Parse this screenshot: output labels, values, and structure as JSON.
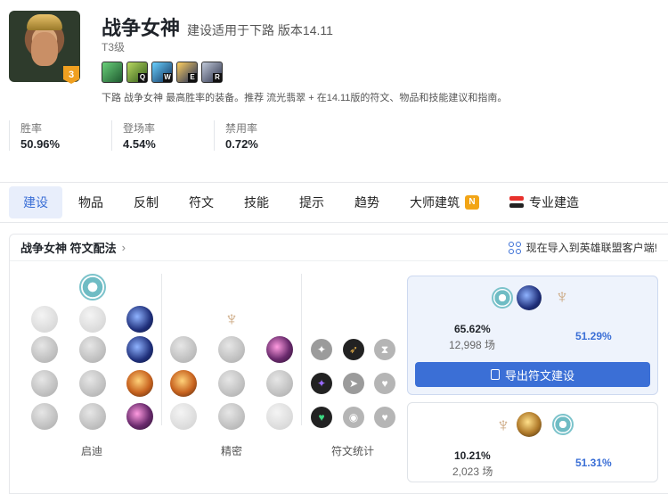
{
  "champion": {
    "name": "战争女神",
    "subtitle": "建设适用于下路 版本14.11",
    "tier_badge": "3",
    "tier_text": "T3级",
    "description": "下路 战争女神 最高胜率的装备。推荐 流光翡翠 + 在14.11版的符文、物品和技能建议和指南。"
  },
  "skills": [
    {
      "key": "",
      "name": "passive-icon",
      "color": "#2f8a4f"
    },
    {
      "key": "Q",
      "name": "skill-q-icon",
      "color": "#4f8a2a"
    },
    {
      "key": "W",
      "name": "skill-w-icon",
      "color": "#2a6aa0"
    },
    {
      "key": "E",
      "name": "skill-e-icon",
      "color": "#c98a1a"
    },
    {
      "key": "R",
      "name": "skill-r-icon",
      "color": "#3a4a6a"
    }
  ],
  "stats": [
    {
      "label": "胜率",
      "value": "50.96%"
    },
    {
      "label": "登场率",
      "value": "4.54%"
    },
    {
      "label": "禁用率",
      "value": "0.72%"
    }
  ],
  "tabs": [
    {
      "label": "建设",
      "active": true
    },
    {
      "label": "物品"
    },
    {
      "label": "反制"
    },
    {
      "label": "符文"
    },
    {
      "label": "技能"
    },
    {
      "label": "提示"
    },
    {
      "label": "趋势"
    },
    {
      "label": "大师建筑",
      "badge": "N"
    },
    {
      "label": "专业建造"
    }
  ],
  "runes_section": {
    "title": "战争女神 符文配法",
    "import_text": "现在导入到英雄联盟客户端!",
    "col_labels": [
      "启迪",
      "精密",
      "符文统计"
    ]
  },
  "rune_cards": [
    {
      "pick_rate": "65.62%",
      "games": "12,998 场",
      "win_rate": "51.29%",
      "button": "导出符文建设"
    },
    {
      "pick_rate": "10.21%",
      "games": "2,023 场",
      "win_rate": "51.31%"
    }
  ],
  "colors": {
    "accent": "#3b6fd6",
    "badge": "#f2a516"
  }
}
